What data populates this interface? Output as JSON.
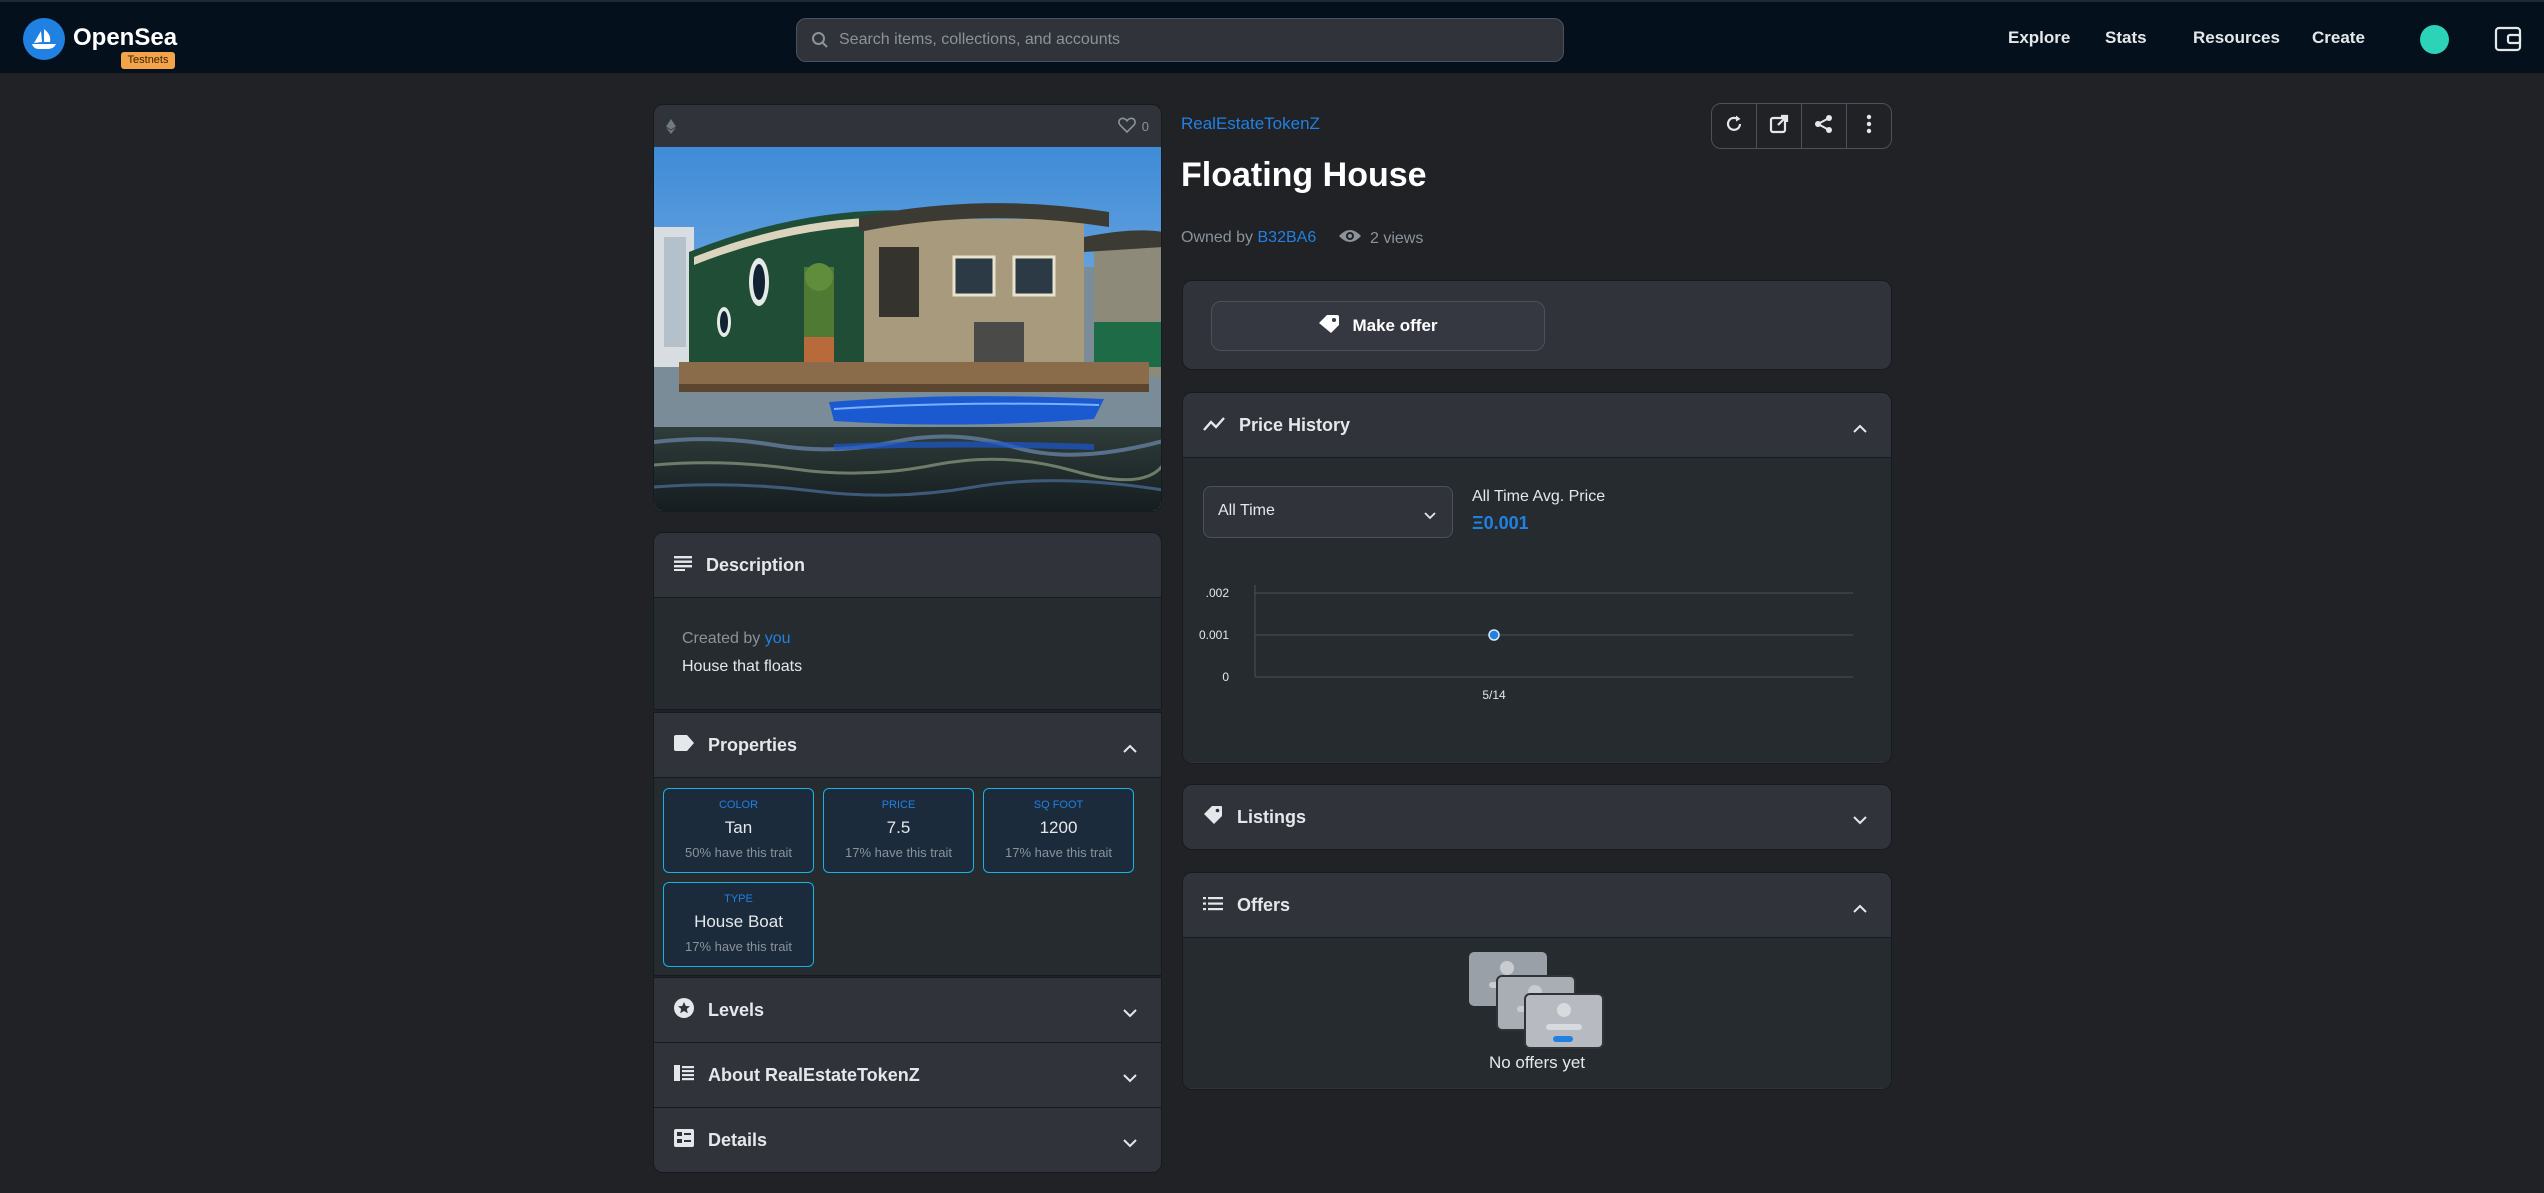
{
  "nav": {
    "brand": "OpenSea",
    "badge": "Testnets",
    "search_placeholder": "Search items, collections, and accounts",
    "links": [
      "Explore",
      "Stats",
      "Resources",
      "Create"
    ]
  },
  "asset": {
    "favorites": "0",
    "description_title": "Description",
    "created_by_prefix": "Created by",
    "created_by_link": "you",
    "description_text": "House that floats",
    "properties_title": "Properties",
    "properties": [
      {
        "key": "COLOR",
        "value": "Tan",
        "rarity": "50% have this trait"
      },
      {
        "key": "PRICE",
        "value": "7.5",
        "rarity": "17% have this trait"
      },
      {
        "key": "SQ FOOT",
        "value": "1200",
        "rarity": "17% have this trait"
      },
      {
        "key": "TYPE",
        "value": "House Boat",
        "rarity": "17% have this trait"
      }
    ],
    "levels_title": "Levels",
    "about_title": "About RealEstateTokenZ",
    "details_title": "Details"
  },
  "header": {
    "collection": "RealEstateTokenZ",
    "name": "Floating House",
    "owned_by_prefix": "Owned by",
    "owner": "B32BA6",
    "views": "2 views"
  },
  "offer": {
    "make_offer": "Make offer"
  },
  "price_history": {
    "title": "Price History",
    "range": "All Time",
    "avg_label": "All Time Avg. Price",
    "avg_value": "Ξ0.001"
  },
  "chart_data": {
    "type": "scatter",
    "x": [
      "5/14"
    ],
    "y": [
      0.001
    ],
    "yticks": [
      ".002",
      "0.001",
      "0"
    ],
    "ylim": [
      0,
      0.002
    ],
    "grid": true
  },
  "listings": {
    "title": "Listings"
  },
  "offers": {
    "title": "Offers",
    "empty": "No offers yet"
  },
  "colors": {
    "accent": "#2081e2",
    "nav_bg": "#04111d",
    "page_bg": "#202225",
    "panel": "#303339",
    "trait_border": "#15b2e5"
  }
}
